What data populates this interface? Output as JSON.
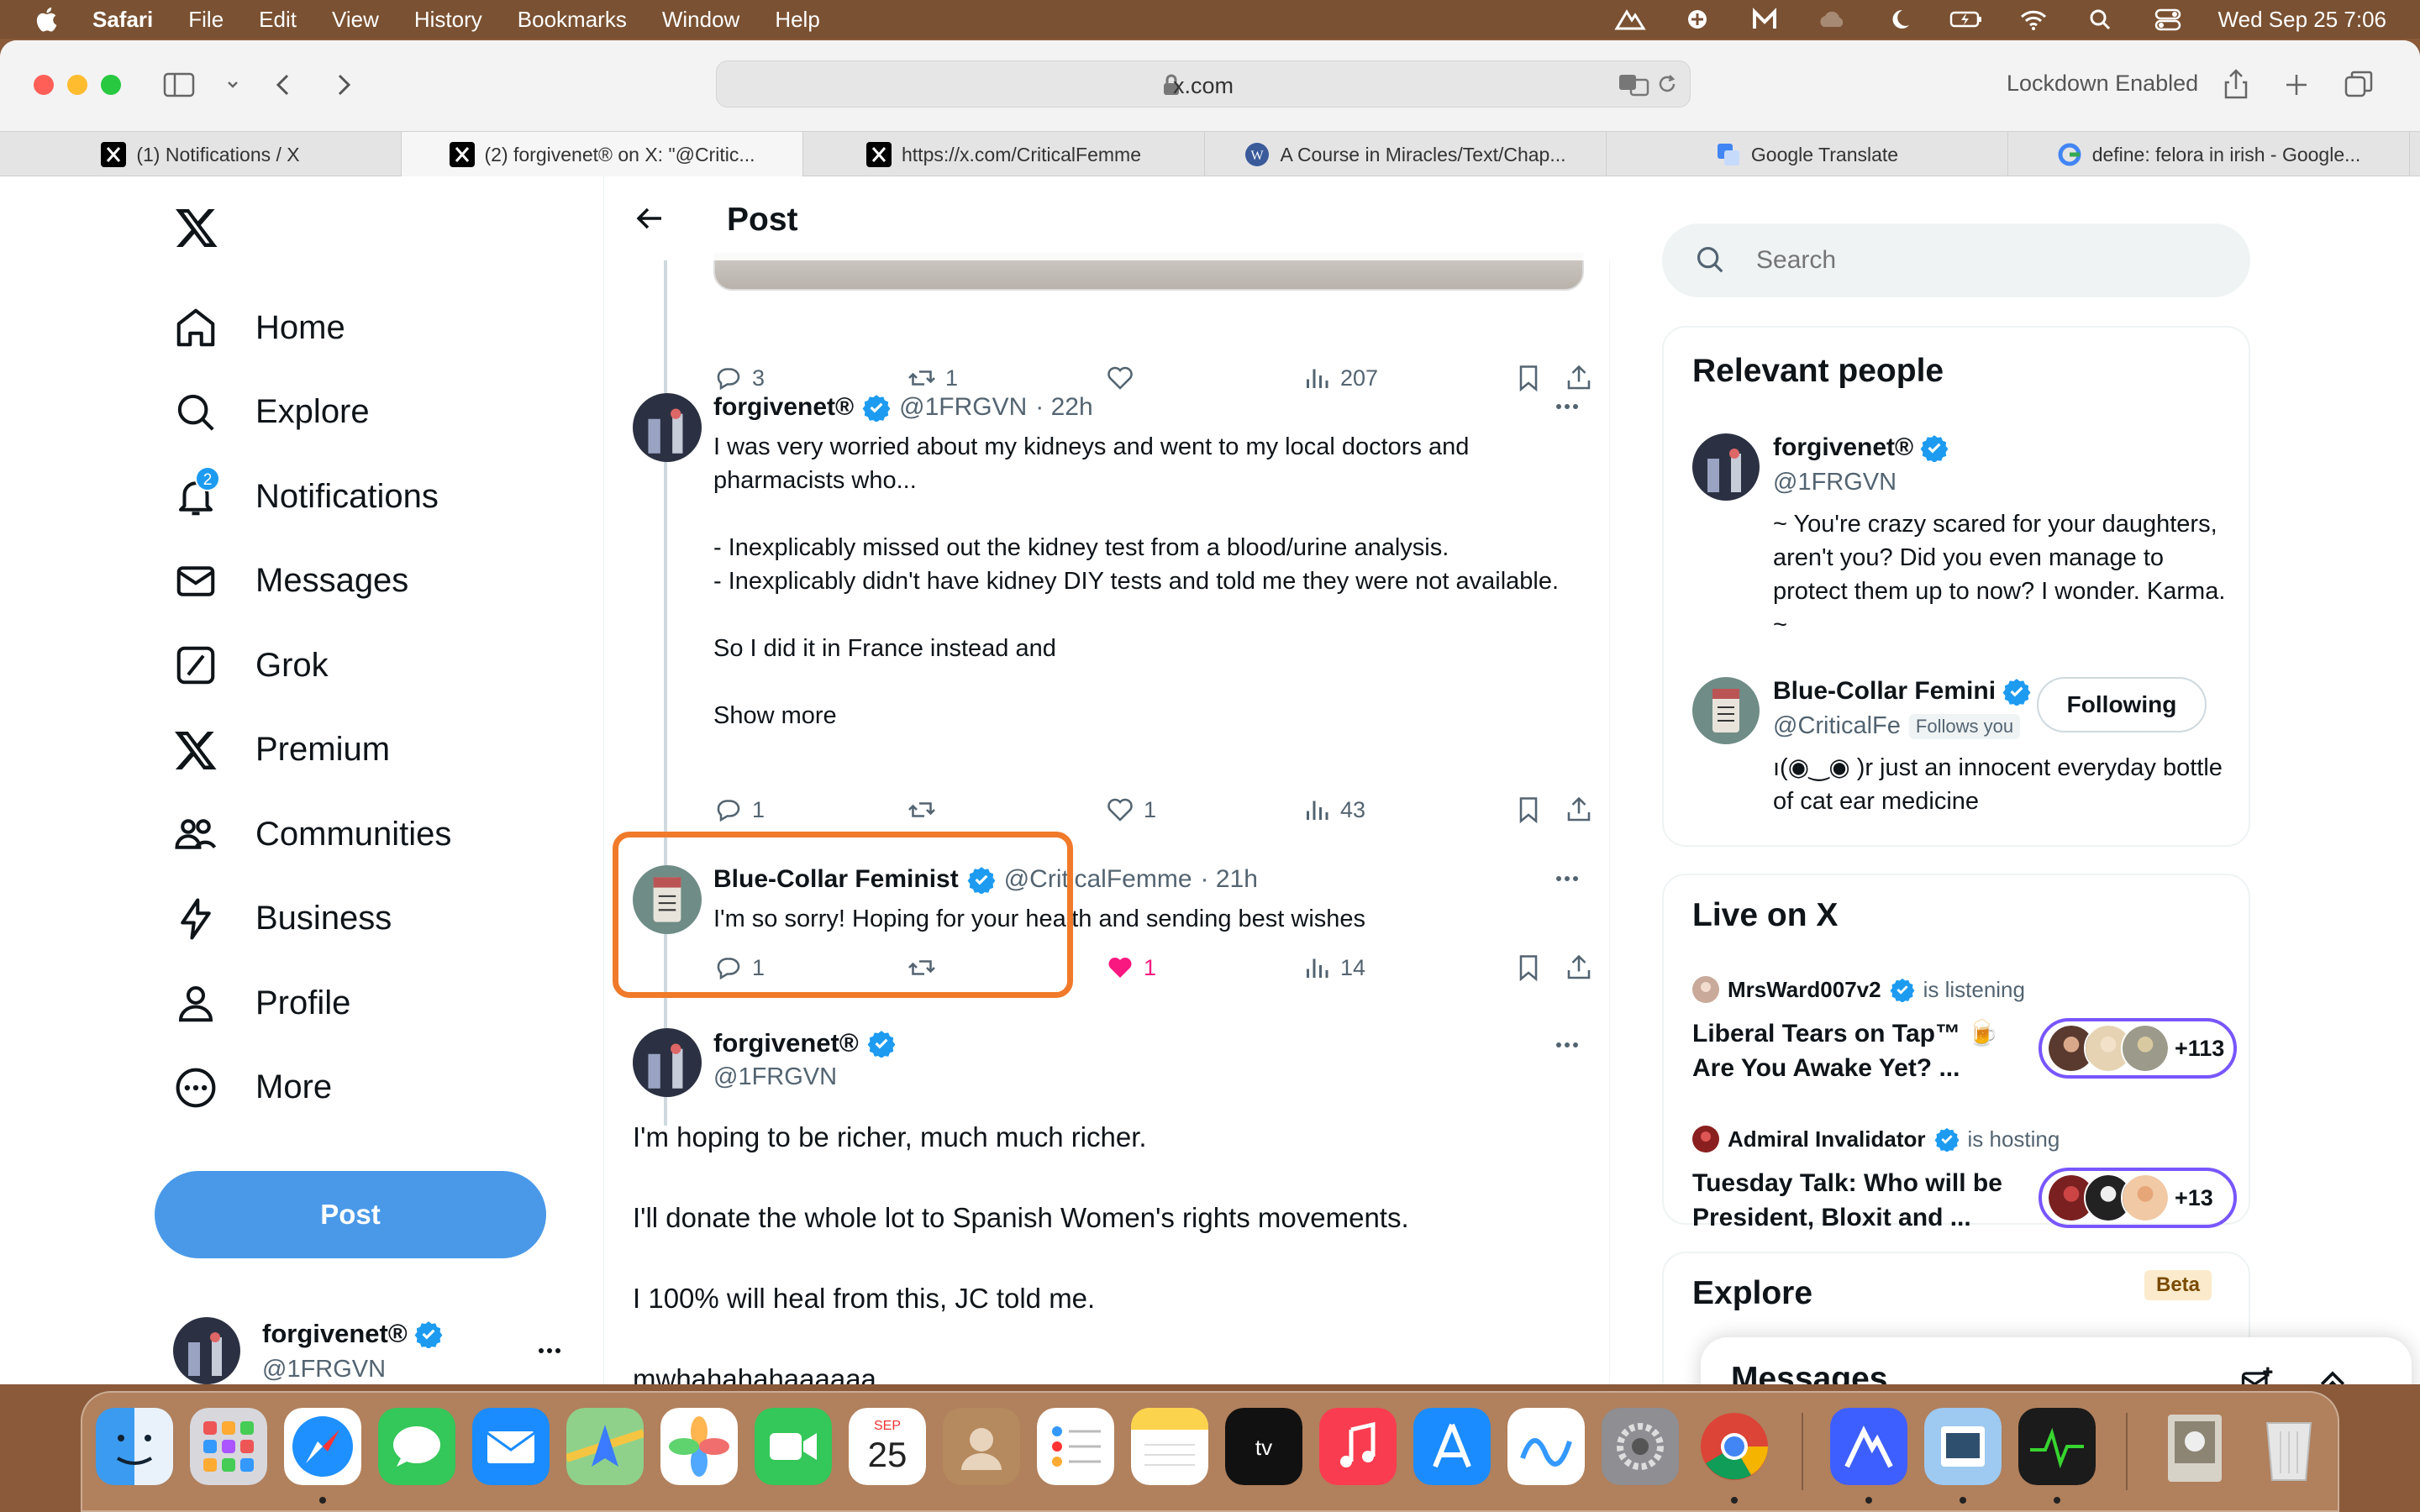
{
  "menubar": {
    "app": "Safari",
    "items": [
      "File",
      "Edit",
      "View",
      "History",
      "Bookmarks",
      "Window",
      "Help"
    ],
    "clock": "Wed Sep 25  7:06"
  },
  "browser": {
    "url": "x.com",
    "lockdown": "Lockdown Enabled",
    "tabs": [
      {
        "title": "(1) Notifications / X",
        "icon": "x-favicon",
        "active": false
      },
      {
        "title": "(2) forgivenet® on X: \"@Critic...",
        "icon": "x-favicon",
        "active": true
      },
      {
        "title": "https://x.com/CriticalFemme",
        "icon": "x-favicon",
        "active": false
      },
      {
        "title": "A Course in Miracles/Text/Chap...",
        "icon": "wiki-favicon",
        "active": false
      },
      {
        "title": "Google Translate",
        "icon": "translate-favicon",
        "active": false
      },
      {
        "title": "define: felora in irish - Google...",
        "icon": "google-favicon",
        "active": false
      }
    ]
  },
  "sidebar": {
    "items": [
      {
        "label": "Home",
        "icon": "home-icon"
      },
      {
        "label": "Explore",
        "icon": "search-icon"
      },
      {
        "label": "Notifications",
        "icon": "bell-icon",
        "badge": "2"
      },
      {
        "label": "Messages",
        "icon": "mail-icon"
      },
      {
        "label": "Grok",
        "icon": "grok-icon"
      },
      {
        "label": "Premium",
        "icon": "x-premium-icon"
      },
      {
        "label": "Communities",
        "icon": "communities-icon"
      },
      {
        "label": "Business",
        "icon": "lightning-icon"
      },
      {
        "label": "Profile",
        "icon": "person-icon"
      },
      {
        "label": "More",
        "icon": "more-circle-icon"
      }
    ],
    "post_label": "Post",
    "account": {
      "name": "forgivenet®",
      "handle": "@1FRGVN"
    }
  },
  "header": {
    "title": "Post"
  },
  "first_tweet_stats": {
    "replies": "3",
    "reposts": "1",
    "likes": "",
    "views": "207"
  },
  "tweets": [
    {
      "name": "forgivenet®",
      "handle": "@1FRGVN",
      "time": "· 22h",
      "body": "I was very worried about my kidneys and went to my local doctors and pharmacists who...\n\n- Inexplicably missed out the kidney test from a blood/urine analysis.\n- Inexplicably didn't have kidney DIY tests and told me they were not available.\n\nSo I did it in France instead and",
      "show_more": "Show more",
      "replies": "1",
      "reposts": "",
      "likes": "1",
      "views": "43"
    },
    {
      "name": "Blue-Collar Feminist",
      "handle": "@CriticalFemme",
      "time": "· 21h",
      "body": "I'm so sorry! Hoping for your health and sending best wishes",
      "replies": "1",
      "reposts": "",
      "likes": "1",
      "views": "14"
    }
  ],
  "main_tweet": {
    "name": "forgivenet®",
    "handle": "@1FRGVN",
    "paragraphs": [
      "I'm hoping to be richer, much much richer.",
      "I'll donate the whole lot to Spanish Women's rights movements.",
      "I 100% will heal from this, JC told me.",
      "mwhahahahaaaaaa"
    ]
  },
  "search": {
    "placeholder": "Search"
  },
  "relevant": {
    "title": "Relevant people",
    "people": [
      {
        "name": "forgivenet®",
        "handle": "@1FRGVN",
        "bio": "~ You're crazy scared for your daughters, aren't you? Did you even manage to protect them up to now? I wonder. Karma. ~"
      },
      {
        "name": "Blue-Collar Femini",
        "handle": "@CriticalFe",
        "follows_you": "Follows you",
        "button": "Following",
        "bio": "ı(◉‿◉ )r just an innocent everyday bottle of cat ear medicine"
      }
    ]
  },
  "live": {
    "title": "Live on X",
    "spaces": [
      {
        "host": "MrsWard007v2",
        "action": "is listening",
        "title": "Liberal Tears on Tap™ 🍺Are You Awake Yet? ...",
        "count": "+113"
      },
      {
        "host": "Admiral Invalidator",
        "action": "is hosting",
        "title": "Tuesday Talk: Who will be President, Bloxit and ...",
        "count": "+13"
      }
    ]
  },
  "explore": {
    "title": "Explore",
    "badge": "Beta"
  },
  "messages_drawer": {
    "title": "Messages"
  },
  "dock": {
    "apps": [
      "finder",
      "launchpad",
      "safari",
      "messages",
      "mail",
      "maps",
      "photos",
      "facetime",
      "calendar",
      "contacts",
      "reminders",
      "notes",
      "tv",
      "music",
      "app-store",
      "freeform",
      "system-settings",
      "chrome",
      "nordvpn",
      "preview",
      "activity-monitor",
      "downloads",
      "trash"
    ],
    "calendar_month": "SEP",
    "calendar_day": "25"
  },
  "colors": {
    "accent": "#1d9bf0",
    "post_button": "#4a99e9",
    "like": "#f91880",
    "highlight": "#f07a2a"
  }
}
